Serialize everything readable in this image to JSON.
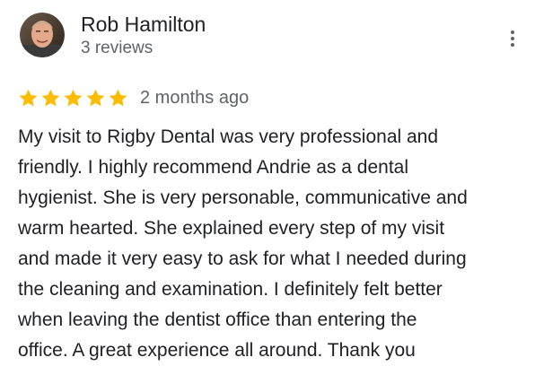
{
  "reviewer": {
    "name": "Rob Hamilton",
    "reviews_count": "3 reviews",
    "avatar_icon": "reviewer-avatar"
  },
  "menu": {
    "icon": "more-vertical-icon"
  },
  "rating": {
    "stars": 5,
    "max": 5,
    "star_color": "#fbbc04",
    "date": "2 months ago"
  },
  "review_lines": [
    "My visit to Rigby Dental was very professional and",
    "friendly. I highly recommend Andrie as a dental",
    "hygienist. She is very personable, communicative and",
    "warm hearted. She explained every step of my visit",
    "and made it very easy to ask for what I needed during",
    "the cleaning and examination. I definitely felt better",
    "when leaving the dentist office than entering the",
    "office. A great experience all around. Thank you"
  ]
}
